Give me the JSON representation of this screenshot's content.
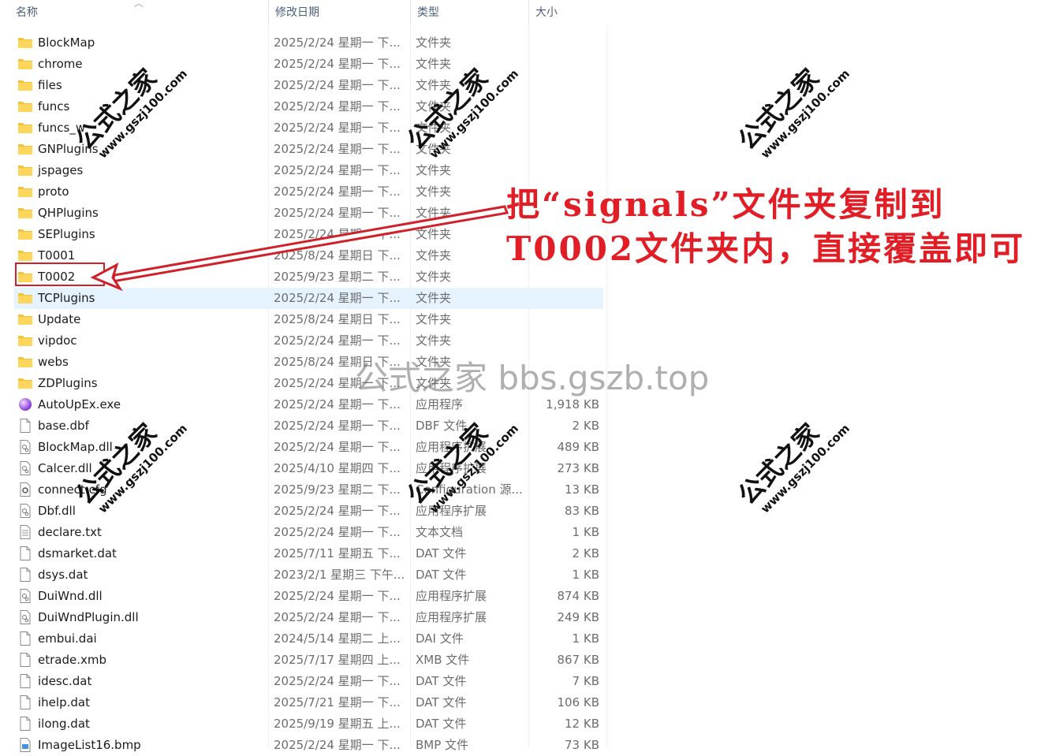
{
  "columns": {
    "name": "名称",
    "date": "修改日期",
    "type": "类型",
    "size": "大小"
  },
  "files": [
    {
      "name": "BlockMap",
      "date": "2025/2/24 星期一 下...",
      "type": "文件夹",
      "size": "",
      "icon": "folder-icon"
    },
    {
      "name": "chrome",
      "date": "2025/2/24 星期一 下...",
      "type": "文件夹",
      "size": "",
      "icon": "folder-icon"
    },
    {
      "name": "files",
      "date": "2025/2/24 星期一 下...",
      "type": "文件夹",
      "size": "",
      "icon": "folder-icon"
    },
    {
      "name": "funcs",
      "date": "2025/2/24 星期一 下...",
      "type": "文件夹",
      "size": "",
      "icon": "folder-icon"
    },
    {
      "name": "funcs_w",
      "date": "2025/2/24 星期一 下...",
      "type": "文件夹",
      "size": "",
      "icon": "folder-icon"
    },
    {
      "name": "GNPlugins",
      "date": "2025/2/24 星期一 下...",
      "type": "文件夹",
      "size": "",
      "icon": "folder-icon"
    },
    {
      "name": "jspages",
      "date": "2025/2/24 星期一 下...",
      "type": "文件夹",
      "size": "",
      "icon": "folder-icon"
    },
    {
      "name": "proto",
      "date": "2025/2/24 星期一 下...",
      "type": "文件夹",
      "size": "",
      "icon": "folder-icon"
    },
    {
      "name": "QHPlugins",
      "date": "2025/2/24 星期一 下...",
      "type": "文件夹",
      "size": "",
      "icon": "folder-icon"
    },
    {
      "name": "SEPlugins",
      "date": "2025/2/24 星期一 下...",
      "type": "文件夹",
      "size": "",
      "icon": "folder-icon"
    },
    {
      "name": "T0001",
      "date": "2025/8/24 星期日 下...",
      "type": "文件夹",
      "size": "",
      "icon": "folder-icon"
    },
    {
      "name": "T0002",
      "date": "2025/9/23 星期二 下...",
      "type": "文件夹",
      "size": "",
      "icon": "folder-icon"
    },
    {
      "name": "TCPlugins",
      "date": "2025/2/24 星期一 下...",
      "type": "文件夹",
      "size": "",
      "icon": "folder-icon",
      "selected": true
    },
    {
      "name": "Update",
      "date": "2025/8/24 星期日 下...",
      "type": "文件夹",
      "size": "",
      "icon": "folder-icon"
    },
    {
      "name": "vipdoc",
      "date": "2025/2/24 星期一 下...",
      "type": "文件夹",
      "size": "",
      "icon": "folder-icon"
    },
    {
      "name": "webs",
      "date": "2025/8/24 星期日 下...",
      "type": "文件夹",
      "size": "",
      "icon": "folder-icon"
    },
    {
      "name": "ZDPlugins",
      "date": "2025/2/24 星期一 下...",
      "type": "文件夹",
      "size": "",
      "icon": "folder-icon"
    },
    {
      "name": "AutoUpEx.exe",
      "date": "2025/2/24 星期一 下...",
      "type": "应用程序",
      "size": "1,918 KB",
      "icon": "exe-icon"
    },
    {
      "name": "base.dbf",
      "date": "2025/2/24 星期一 下...",
      "type": "DBF 文件",
      "size": "2 KB",
      "icon": "file-icon"
    },
    {
      "name": "BlockMap.dll",
      "date": "2025/2/24 星期一 下...",
      "type": "应用程序扩展",
      "size": "489 KB",
      "icon": "dll-icon"
    },
    {
      "name": "Calcer.dll",
      "date": "2025/4/10 星期四 下...",
      "type": "应用程序扩展",
      "size": "273 KB",
      "icon": "dll-icon"
    },
    {
      "name": "connect.cfg",
      "date": "2025/9/23 星期二 下...",
      "type": "Configuration 源...",
      "size": "13 KB",
      "icon": "config-icon"
    },
    {
      "name": "Dbf.dll",
      "date": "2025/2/24 星期一 下...",
      "type": "应用程序扩展",
      "size": "83 KB",
      "icon": "dll-icon"
    },
    {
      "name": "declare.txt",
      "date": "2025/2/24 星期一 下...",
      "type": "文本文档",
      "size": "1 KB",
      "icon": "text-file-icon"
    },
    {
      "name": "dsmarket.dat",
      "date": "2025/7/11 星期五 下...",
      "type": "DAT 文件",
      "size": "2 KB",
      "icon": "file-icon"
    },
    {
      "name": "dsys.dat",
      "date": "2023/2/1 星期三 下午...",
      "type": "DAT 文件",
      "size": "1 KB",
      "icon": "file-icon"
    },
    {
      "name": "DuiWnd.dll",
      "date": "2025/2/24 星期一 下...",
      "type": "应用程序扩展",
      "size": "874 KB",
      "icon": "dll-icon"
    },
    {
      "name": "DuiWndPlugin.dll",
      "date": "2025/2/24 星期一 下...",
      "type": "应用程序扩展",
      "size": "249 KB",
      "icon": "dll-icon"
    },
    {
      "name": "embui.dai",
      "date": "2024/5/14 星期二 上...",
      "type": "DAI 文件",
      "size": "1 KB",
      "icon": "file-icon"
    },
    {
      "name": "etrade.xmb",
      "date": "2025/7/17 星期四 上...",
      "type": "XMB 文件",
      "size": "867 KB",
      "icon": "file-icon"
    },
    {
      "name": "idesc.dat",
      "date": "2025/2/24 星期一 下...",
      "type": "DAT 文件",
      "size": "7 KB",
      "icon": "file-icon"
    },
    {
      "name": "ihelp.dat",
      "date": "2025/7/21 星期一 下...",
      "type": "DAT 文件",
      "size": "106 KB",
      "icon": "file-icon"
    },
    {
      "name": "ilong.dat",
      "date": "2025/9/19 星期五 上...",
      "type": "DAT 文件",
      "size": "12 KB",
      "icon": "file-icon"
    },
    {
      "name": "ImageList16.bmp",
      "date": "2025/2/24 星期一 下...",
      "type": "BMP 文件",
      "size": "73 KB",
      "icon": "image-icon"
    }
  ],
  "annotation": {
    "line1": "把“signals”文件夹复制到",
    "line2": "T0002文件夹内，直接覆盖即可",
    "color": "#e11d26"
  },
  "watermark": {
    "center": "公式之家 bbs.gszb.top",
    "stamp_cn": "公式之家",
    "stamp_url": "www.gszj100.com"
  }
}
